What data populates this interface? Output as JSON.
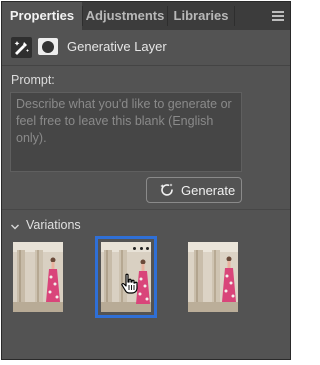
{
  "tabs": [
    {
      "label": "Properties",
      "active": true
    },
    {
      "label": "Adjustments",
      "active": false
    },
    {
      "label": "Libraries",
      "active": false
    }
  ],
  "panel_menu_icon": "hamburger-menu-icon",
  "layer": {
    "type_icon": "generative-fill-icon",
    "mask_icon": "layer-mask-icon",
    "title": "Generative Layer"
  },
  "prompt": {
    "label": "Prompt:",
    "value": "",
    "placeholder": "Describe what you'd like to generate or feel free to leave this blank (English only)."
  },
  "generate_button": {
    "icon": "generate-refresh-icon",
    "label": "Generate"
  },
  "variations": {
    "label": "Variations",
    "expanded": true,
    "thumbnails": [
      {
        "selected": false
      },
      {
        "selected": true,
        "has_more_menu": true
      },
      {
        "selected": false
      }
    ]
  },
  "colors": {
    "panel_bg": "#535353",
    "tabbar_bg": "#3c3c3c",
    "selection_outline": "#2f6fd6"
  }
}
